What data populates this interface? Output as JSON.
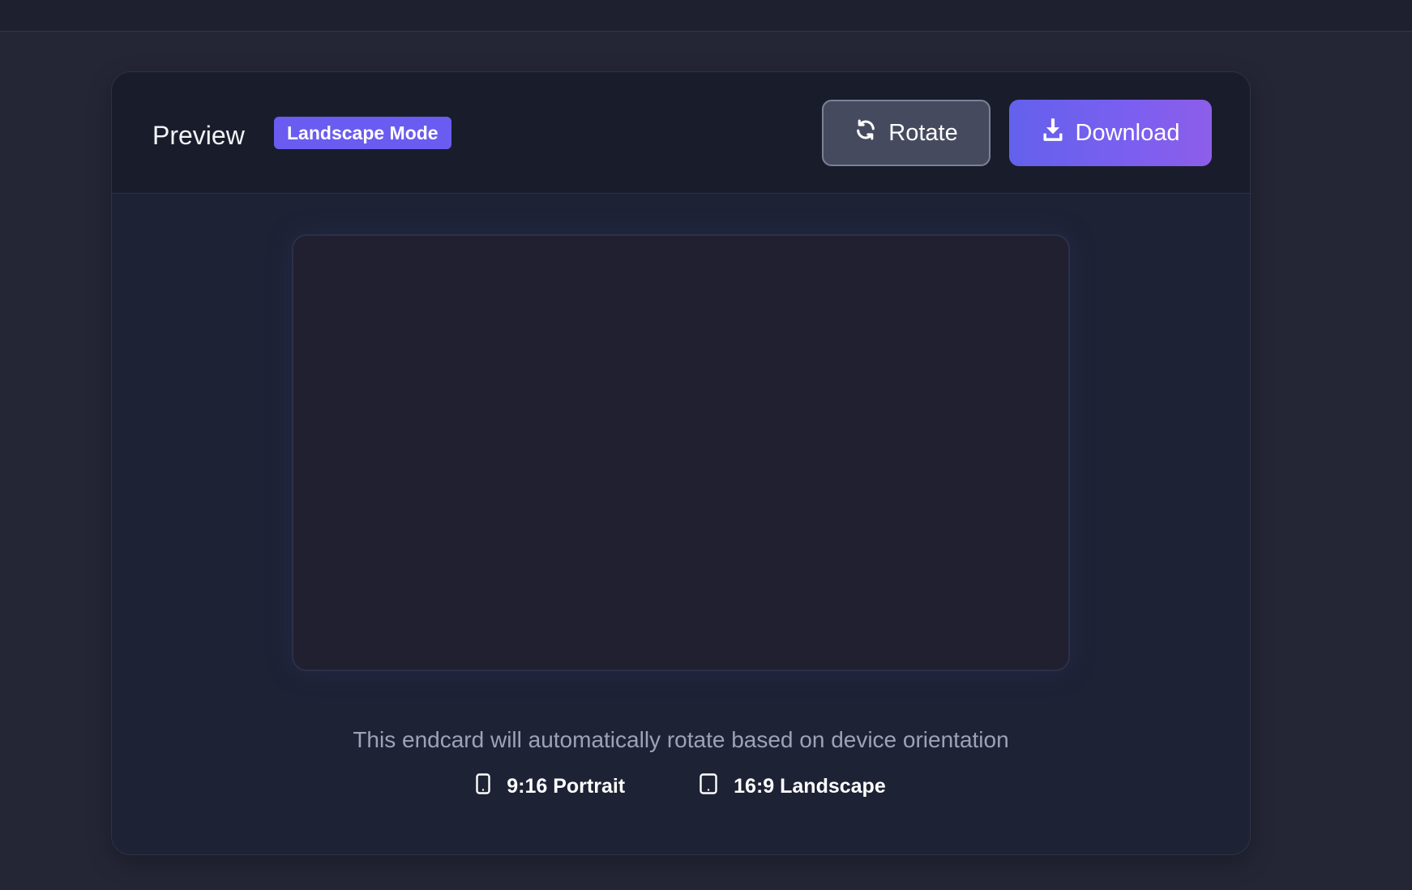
{
  "preview": {
    "title": "Preview",
    "mode_badge": "Landscape Mode",
    "rotate_label": "Rotate",
    "download_label": "Download",
    "note": "This endcard will automatically rotate based on device orientation",
    "formats": [
      {
        "icon": "mobile-phone-icon",
        "label": "9:16 Portrait"
      },
      {
        "icon": "tablet-icon",
        "label": "16:9 Landscape"
      }
    ]
  },
  "colors": {
    "background": "#242636",
    "card": "#1e2235",
    "header": "#191d2b",
    "accent": "#6a5cf0",
    "download_gradient_start": "#6361ec",
    "download_gradient_end": "#8d5ee9",
    "rotate_button": "#454a5e",
    "muted_text": "#9ea2b6"
  }
}
